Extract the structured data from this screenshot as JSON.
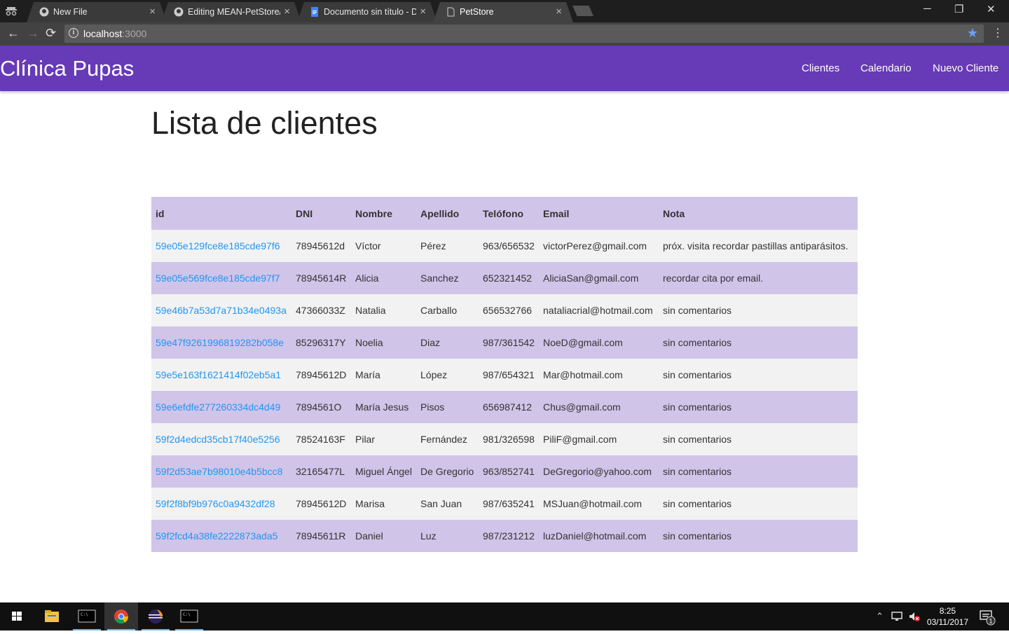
{
  "browser": {
    "tabs": [
      {
        "title": "New File",
        "icon": "github-icon",
        "active": false
      },
      {
        "title": "Editing MEAN-PetStore/R",
        "icon": "github-icon",
        "active": false
      },
      {
        "title": "Documento sin título - D",
        "icon": "google-docs-icon",
        "active": false
      },
      {
        "title": "PetStore",
        "icon": "page-icon",
        "active": true
      }
    ],
    "window_controls": {
      "minimize": "─",
      "restore": "❐",
      "close": "✕"
    },
    "url_host": "localhost",
    "url_port": ":3000"
  },
  "app": {
    "brand": "Clínica Pupas",
    "nav": [
      "Clientes",
      "Calendario",
      "Nuevo Cliente"
    ],
    "accent_color": "#673ab7",
    "row_alt_color": "#d1c4e9",
    "link_color": "#2196f3"
  },
  "page": {
    "title": "Lista de clientes"
  },
  "table": {
    "headers": [
      "id",
      "DNI",
      "Nombre",
      "Apellido",
      "Telófono",
      "Email",
      "Nota"
    ],
    "rows": [
      [
        "59e05e129fce8e185cde97f6",
        "78945612d",
        "Víctor",
        "Pérez",
        "963/656532",
        "victorPerez@gmail.com",
        "próx. visita recordar pastillas antiparásitos."
      ],
      [
        "59e05e569fce8e185cde97f7",
        "78945614R",
        "Alicia",
        "Sanchez",
        "652321452",
        "AliciaSan@gmail.com",
        "recordar cita por email."
      ],
      [
        "59e46b7a53d7a71b34e0493a",
        "47366033Z",
        "Natalia",
        "Carballo",
        "656532766",
        "nataliacrial@hotmail.com",
        "sin comentarios"
      ],
      [
        "59e47f9261996819282b058e",
        "85296317Y",
        "Noelia",
        "Diaz",
        "987/361542",
        "NoeD@gmail.com",
        "sin comentarios"
      ],
      [
        "59e5e163f1621414f02eb5a1",
        "78945612D",
        "María",
        "López",
        "987/654321",
        "Mar@hotmail.com",
        "sin comentarios"
      ],
      [
        "59e6efdfe277260334dc4d49",
        "7894561O",
        "María Jesus",
        "Pisos",
        "656987412",
        "Chus@gmail.com",
        "sin comentarios"
      ],
      [
        "59f2d4edcd35cb17f40e5256",
        "78524163F",
        "Pilar",
        "Fernández",
        "981/326598",
        "PiliF@gmail.com",
        "sin comentarios"
      ],
      [
        "59f2d53ae7b98010e4b5bcc8",
        "32165477L",
        "Miguel Ángel",
        "De Gregorio",
        "963/852741",
        "DeGregorio@yahoo.com",
        "sin comentarios"
      ],
      [
        "59f2f8bf9b976c0a9432df28",
        "78945612D",
        "Marisa",
        "San Juan",
        "987/635241",
        "MSJuan@hotmail.com",
        "sin comentarios"
      ],
      [
        "59f2fcd4a38fe2222873ada5",
        "78945611R",
        "Daniel",
        "Luz",
        "987/231212",
        "luzDaniel@hotmail.com",
        "sin comentarios"
      ]
    ]
  },
  "taskbar": {
    "time": "8:25",
    "date": "03/11/2017",
    "notification_count": "1"
  }
}
